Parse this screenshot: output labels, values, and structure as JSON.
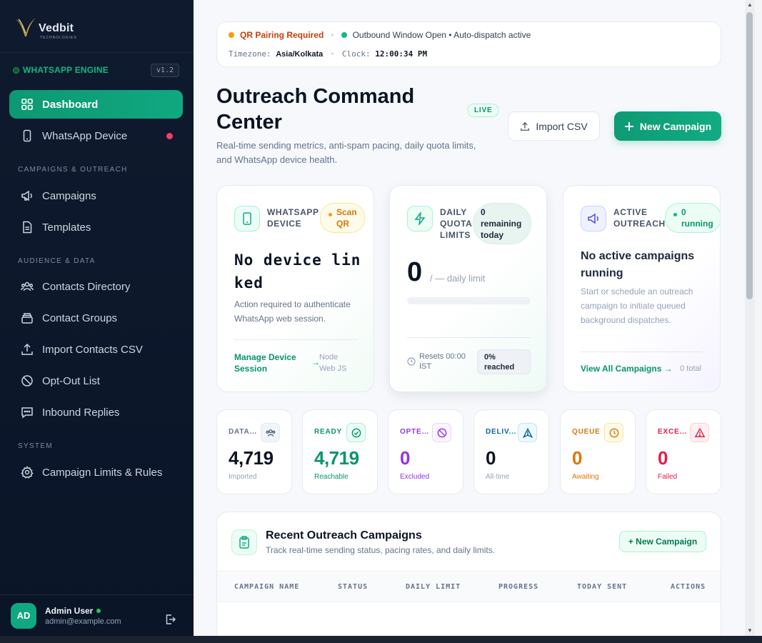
{
  "brand": {
    "name": "Vedbit",
    "tagline": "TECHNOLOGIES"
  },
  "engine": {
    "label": "WHATSAPP ENGINE",
    "version": "v1.2"
  },
  "nav": {
    "dashboard": "Dashboard",
    "device": "WhatsApp Device",
    "section_campaigns": "CAMPAIGNS & OUTREACH",
    "campaigns": "Campaigns",
    "templates": "Templates",
    "section_audience": "AUDIENCE & DATA",
    "contacts": "Contacts Directory",
    "groups": "Contact Groups",
    "import": "Import Contacts CSV",
    "optout": "Opt-Out List",
    "inbound": "Inbound Replies",
    "section_system": "SYSTEM",
    "limits": "Campaign Limits & Rules"
  },
  "user": {
    "initials": "AD",
    "name": "Admin User",
    "email": "admin@example.com"
  },
  "status": {
    "qr": "QR Pairing Required",
    "outbound": "Outbound Window Open • Auto-dispatch active",
    "timezone_label": "Timezone:",
    "timezone": "Asia/Kolkata",
    "clock_label": "Clock:",
    "clock": "12:00:34 PM"
  },
  "header": {
    "title": "Outreach Command Center",
    "live": "LIVE",
    "subtitle": "Real-time sending metrics, anti-spam pacing, daily quota limits, and WhatsApp device health.",
    "import_btn": "Import CSV",
    "new_btn": "New Campaign"
  },
  "device_card": {
    "label1": "WHATSAPP",
    "label2": "DEVICE",
    "pill1": "Scan",
    "pill2": "QR",
    "status1": "No device lin",
    "status2": "ked",
    "desc": "Action required to authenticate WhatsApp web session.",
    "link1": "Manage Device",
    "link2": "Session",
    "meta1": "Node",
    "meta2": "Web JS"
  },
  "quota_card": {
    "label1": "DAILY",
    "label2": "QUOTA",
    "label3": "LIMITS",
    "pill1": "0",
    "pill2": "remaining",
    "pill3": "today",
    "value": "0",
    "value_suffix": "/ — daily limit",
    "progress": 0,
    "reset1": "Resets 00:00",
    "reset2": "IST",
    "reached1": "0%",
    "reached2": "reached"
  },
  "outreach_card": {
    "label1": "ACTIVE",
    "label2": "OUTREACH",
    "pill1": "0",
    "pill2": "running",
    "headline": "No active campaigns running",
    "desc": "Start or schedule an outreach campaign to initiate queued background dispatches.",
    "link": "View All Campaigns",
    "total": "0 total"
  },
  "stats": [
    {
      "label": "DATAB...",
      "value": "4,719",
      "sub": "Imported",
      "color": "#0b1424",
      "icon": "users-icon"
    },
    {
      "label": "READY",
      "value": "4,719",
      "sub": "Reachable",
      "color": "#059669",
      "icon": "check-circle-icon"
    },
    {
      "label": "OPTED...",
      "value": "0",
      "sub": "Excluded",
      "color": "#9333ea",
      "icon": "ban-icon"
    },
    {
      "label": "DELIV...",
      "value": "0",
      "sub": "All-time",
      "color": "#0b1424",
      "icon": "send-icon"
    },
    {
      "label": "QUEUE",
      "value": "0",
      "sub": "Awaiting",
      "color": "#d97706",
      "icon": "clock-icon"
    },
    {
      "label": "EXCEP...",
      "value": "0",
      "sub": "Failed",
      "color": "#e11d48",
      "icon": "alert-triangle-icon"
    }
  ],
  "recent": {
    "title": "Recent Outreach Campaigns",
    "subtitle": "Track real-time sending status, pacing rates, and daily limits.",
    "new_btn": "+ New Campaign",
    "columns": [
      "CAMPAIGN NAME",
      "STATUS",
      "DAILY LIMIT",
      "PROGRESS",
      "TODAY SENT",
      "ACTIONS"
    ]
  },
  "colors": {
    "accent": "#10a880",
    "sidebar": "#0f1a2e",
    "danger": "#f43f5e"
  }
}
